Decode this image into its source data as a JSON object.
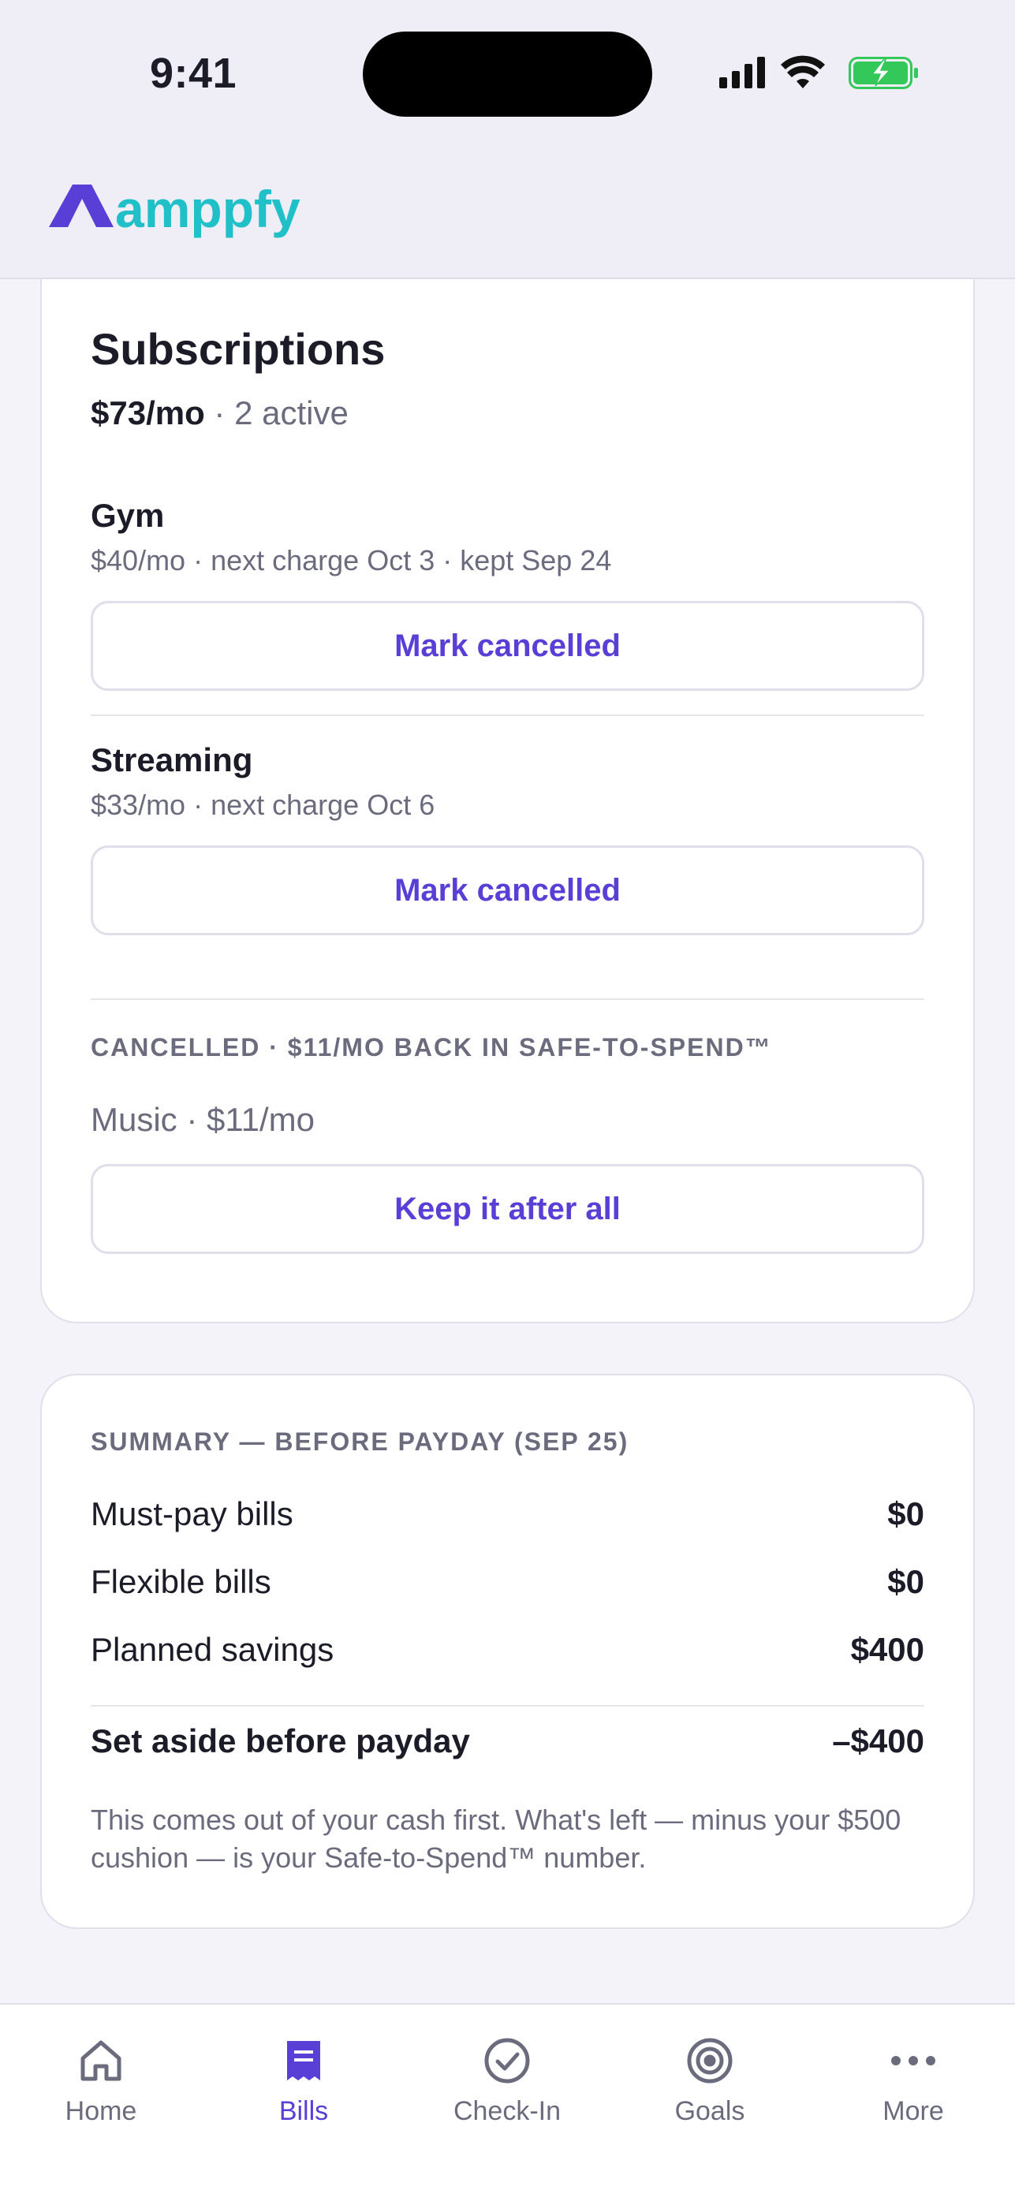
{
  "status_bar": {
    "time": "9:41"
  },
  "header": {
    "logo_text": "amppfy"
  },
  "colors": {
    "accent": "#5a3fd6",
    "logo_teal": "#1fc0c8",
    "logo_purple": "#5a3fd6",
    "battery_green": "#34c759"
  },
  "subscriptions": {
    "title": "Subscriptions",
    "total_amount": "$73/mo",
    "total_suffix": " · 2 active",
    "items": [
      {
        "name": "Gym",
        "meta": "$40/mo · next charge Oct 3 · kept Sep 24",
        "action": "Mark cancelled"
      },
      {
        "name": "Streaming",
        "meta": "$33/mo · next charge Oct 6",
        "action": "Mark cancelled"
      }
    ],
    "cancelled_heading": "CANCELLED · $11/MO BACK IN SAFE-TO-SPEND™",
    "cancelled_item": "Music · $11/mo",
    "cancelled_action": "Keep it after all"
  },
  "summary": {
    "heading": "SUMMARY — BEFORE PAYDAY (SEP 25)",
    "rows": [
      {
        "label": "Must-pay bills",
        "value": "$0"
      },
      {
        "label": "Flexible bills",
        "value": "$0"
      },
      {
        "label": "Planned savings",
        "value": "$400"
      }
    ],
    "total_label": "Set aside before payday",
    "total_value": "–$400",
    "note": "This comes out of your cash first. What's left — minus your $500 cushion — is your Safe-to-Spend™ number."
  },
  "tabs": [
    {
      "label": "Home",
      "icon": "home-icon"
    },
    {
      "label": "Bills",
      "icon": "bills-icon",
      "active": true
    },
    {
      "label": "Check-In",
      "icon": "check-in-icon"
    },
    {
      "label": "Goals",
      "icon": "goals-icon"
    },
    {
      "label": "More",
      "icon": "more-icon"
    }
  ]
}
